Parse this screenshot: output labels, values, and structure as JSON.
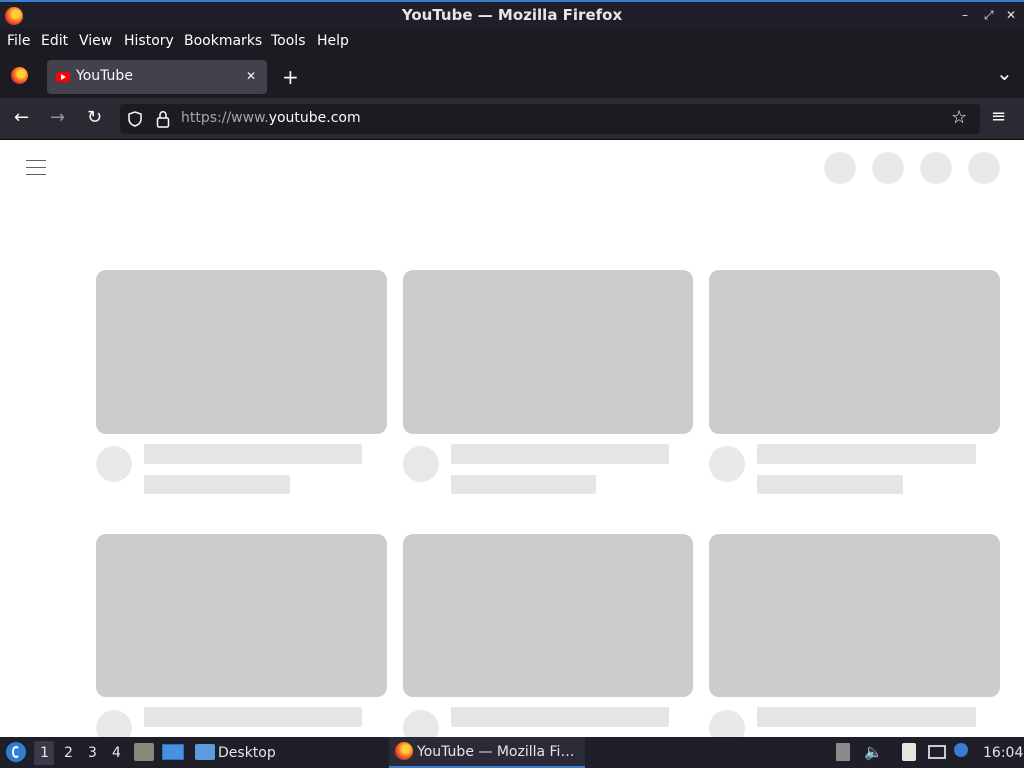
{
  "window": {
    "title": "YouTube — Mozilla Firefox",
    "controls": [
      "–",
      "⤢",
      "✕"
    ]
  },
  "menu": [
    "File",
    "Edit",
    "View",
    "History",
    "Bookmarks",
    "Tools",
    "Help"
  ],
  "tabs": [
    {
      "label": "YouTube",
      "close": "✕",
      "active": true
    }
  ],
  "tabbar": {
    "new_tab": "+",
    "list_all": "⌄"
  },
  "nav": {
    "back": "←",
    "forward": "→",
    "reload": "↻",
    "url_prefix": "https://www.",
    "url_domain": "youtube.com",
    "bookmark": "☆",
    "menu": "≡"
  },
  "page": {
    "menu_icon": "hamburger-icon",
    "loading": true
  },
  "taskbar": {
    "workspaces": [
      "1",
      "2",
      "3",
      "4"
    ],
    "active_workspace": "1",
    "desktop_label": "Desktop",
    "active_window": "YouTube — Mozilla Fi…",
    "clock": "16:04"
  },
  "colors": {
    "accent": "#3a7bd5",
    "skeleton": "#cccccc",
    "youtube_red": "#ff0000"
  }
}
